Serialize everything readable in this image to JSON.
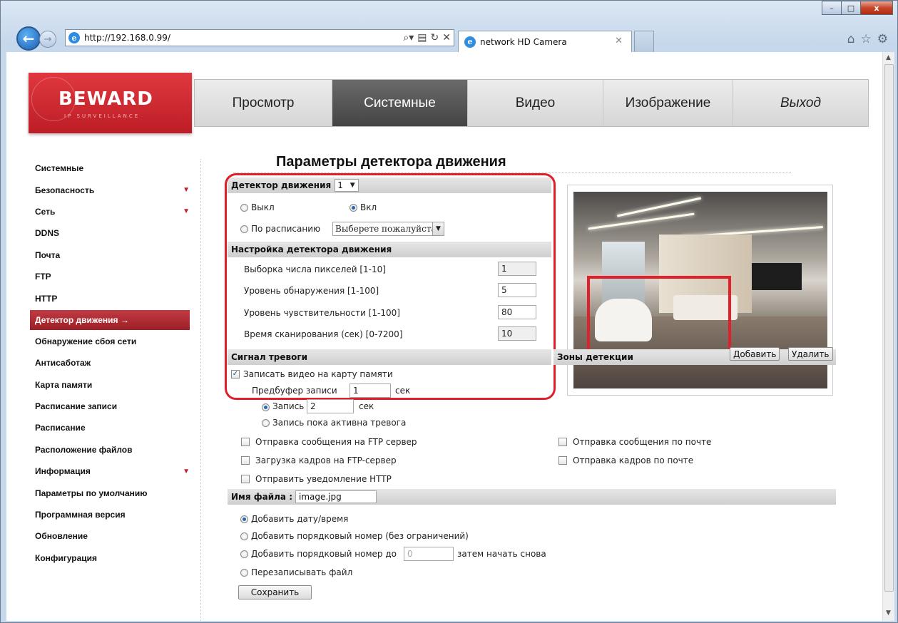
{
  "browser": {
    "url": "http://192.168.0.99/",
    "tab_title": "network HD Camera",
    "win_min": "–",
    "win_max": "□",
    "win_close": "x"
  },
  "logo": {
    "text": "BEWARD",
    "subtitle": "IP SURVEILLANCE"
  },
  "main_nav": [
    "Просмотр",
    "Системные",
    "Видео",
    "Изображение",
    "Выход"
  ],
  "sidebar": {
    "items": [
      "Системные",
      "Безопасность",
      "Сеть",
      "DDNS",
      "Почта",
      "FTP",
      "HTTP",
      "Детектор движения",
      "Обнаружение сбоя сети",
      "Антисаботаж",
      "Карта памяти",
      "Расписание записи",
      "Расписание",
      "Расположение файлов",
      "Информация",
      "Параметры по умолчанию",
      "Программная версия",
      "Обновление",
      "Конфигурация"
    ],
    "active_arrow": "→"
  },
  "page_title": "Параметры детектора движения",
  "detector": {
    "label": "Детектор движения",
    "selected": "1",
    "off_label": "Выкл",
    "on_label": "Вкл",
    "schedule_label": "По расписанию",
    "schedule_select": "Выберете пожалуйста"
  },
  "settings": {
    "header": "Настройка детектора движения",
    "rows": [
      {
        "label": "Выборка числа пикселей [1-10]",
        "value": "1"
      },
      {
        "label": "Уровень обнаружения [1-100]",
        "value": "5"
      },
      {
        "label": "Уровень чувствительности [1-100]",
        "value": "80"
      },
      {
        "label": "Время сканирования (сек) [0-7200]",
        "value": "10"
      }
    ]
  },
  "zones": {
    "label": "Зоны детекции",
    "add": "Добавить",
    "delete": "Удалить"
  },
  "alarm": {
    "header": "Сигнал тревоги",
    "record_to_card": "Записать видео на карту памяти",
    "prebuffer_label": "Предбуфер записи",
    "prebuffer_value": "1",
    "sec": "сек",
    "record_label": "Запись",
    "record_value": "2",
    "record_while_active": "Запись пока активна тревога",
    "ftp_message": "Отправка сообщения на FTP сервер",
    "email_message": "Отправка сообщения по почте",
    "ftp_upload": "Загрузка кадров на FTP-сервер",
    "email_frames": "Отправка кадров по почте",
    "http_notify": "Отправить уведомление HTTP"
  },
  "filename": {
    "label": "Имя файла :",
    "value": "image.jpg",
    "opt_datetime": "Добавить дату/время",
    "opt_seq_unlimited": "Добавить порядковый номер (без ограничений)",
    "opt_seq_to": "Добавить порядковый номер до",
    "seq_to_value": "0",
    "restart_label": "затем начать снова",
    "opt_overwrite": "Перезаписывать файл"
  },
  "save_button": "Сохранить"
}
